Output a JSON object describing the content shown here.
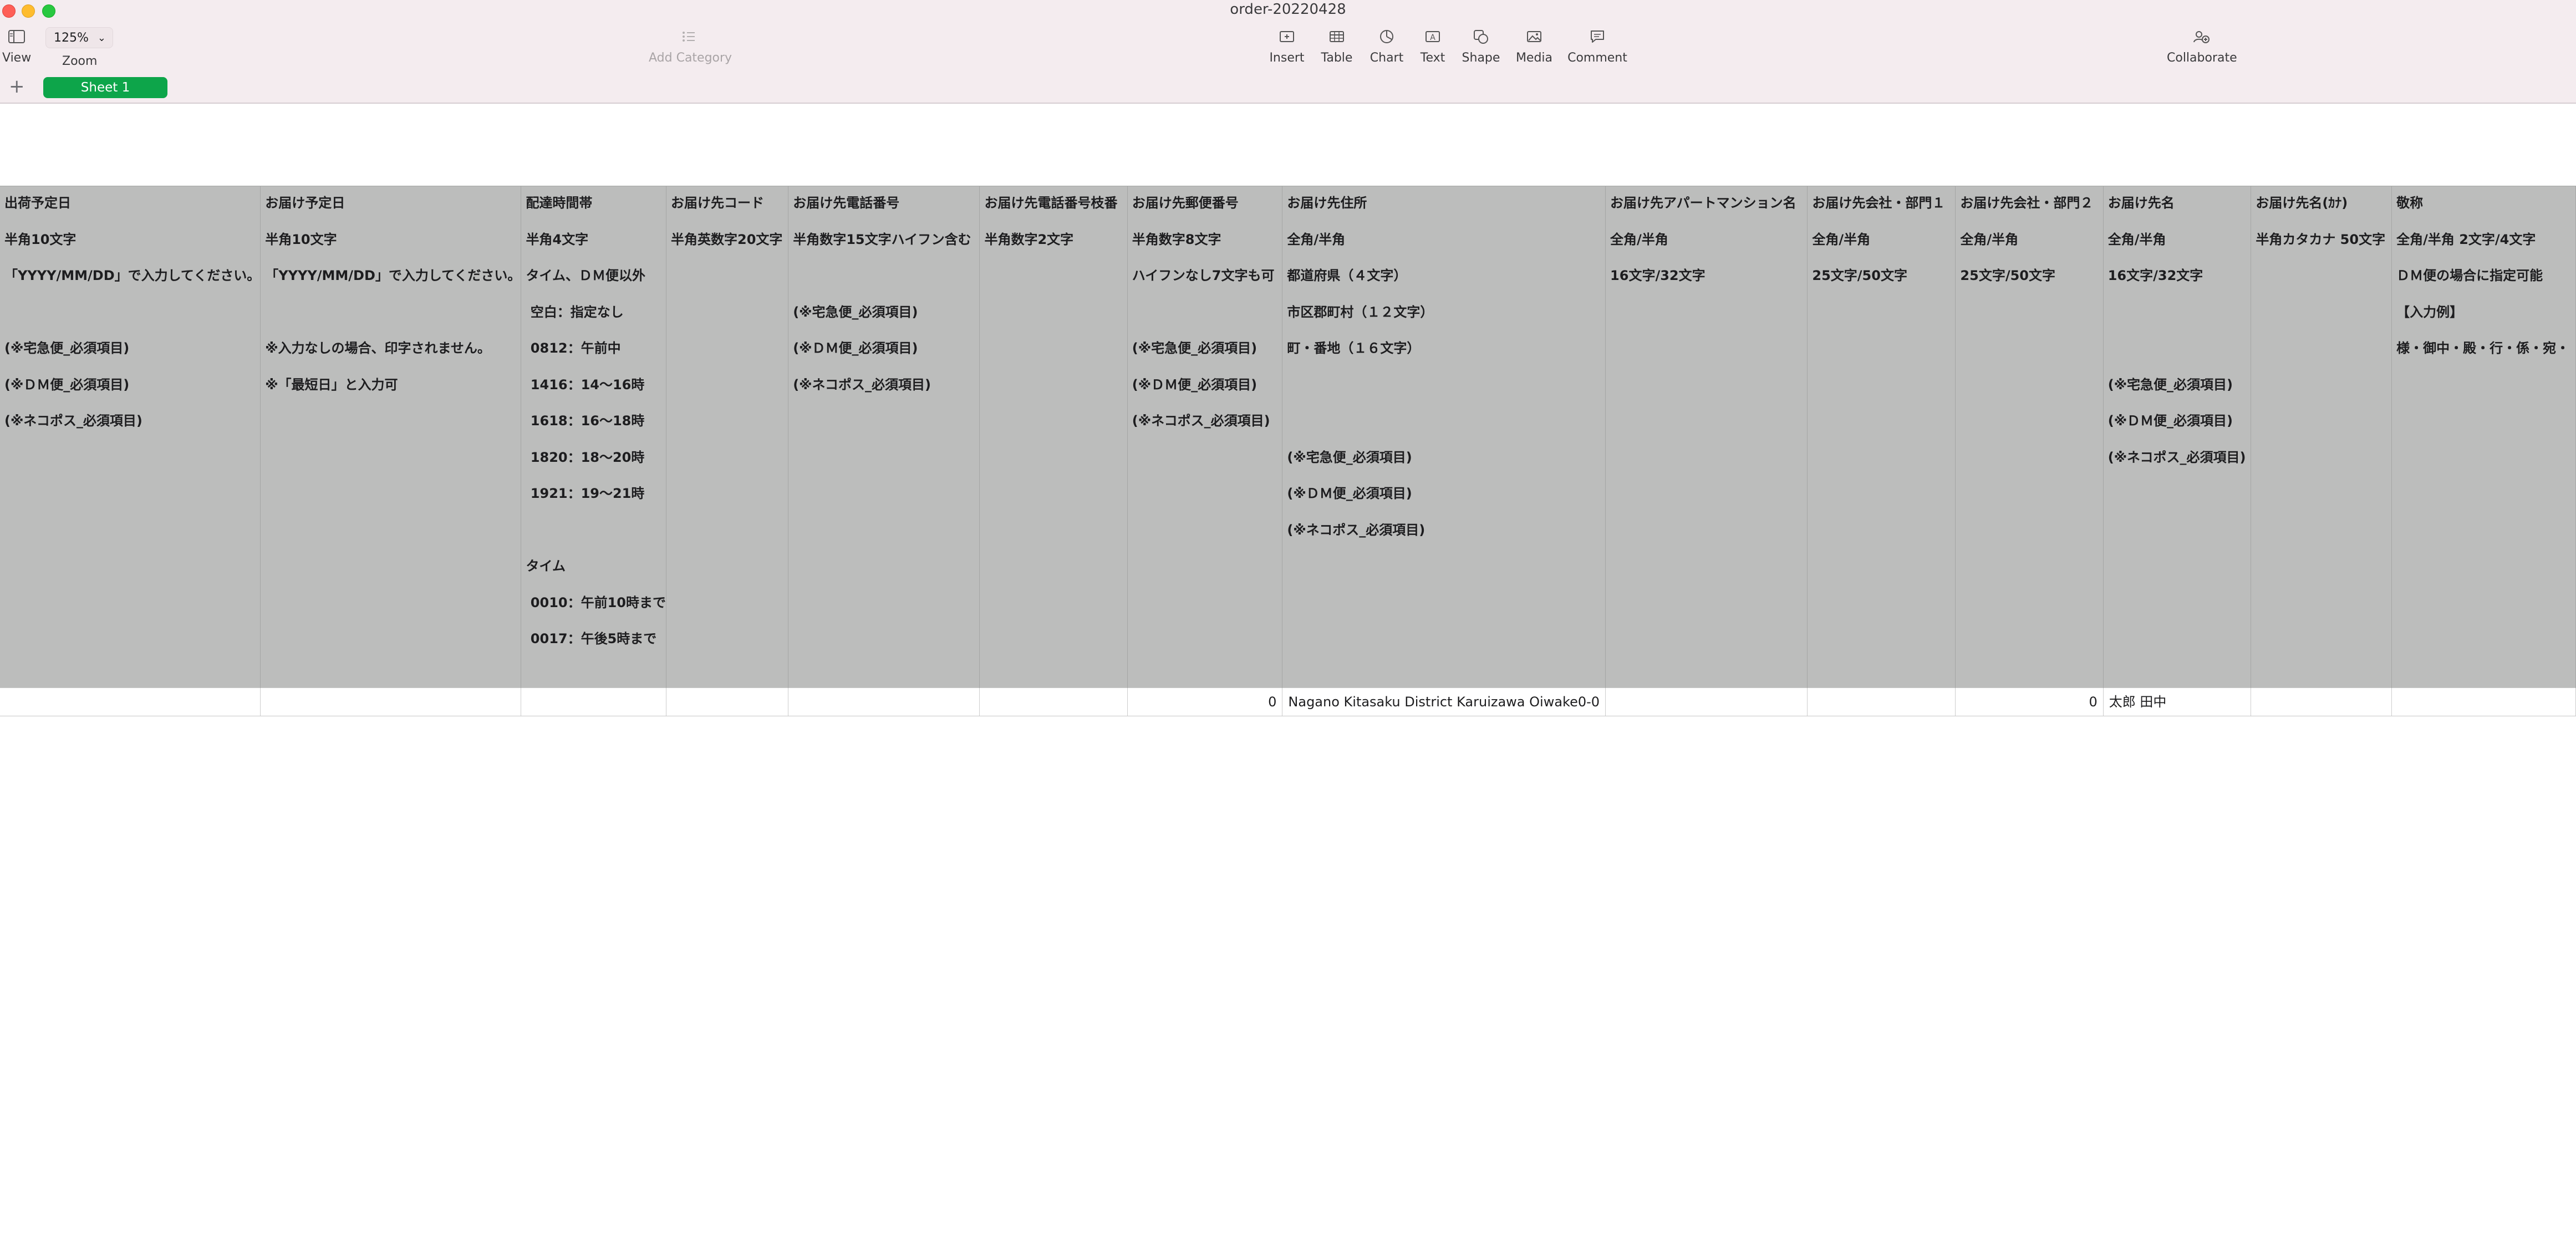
{
  "window": {
    "title": "order-20220428"
  },
  "toolbar": {
    "view_label": "View",
    "zoom_value": "125%",
    "zoom_label": "Zoom",
    "add_category_label": "Add Category",
    "insert_label": "Insert",
    "table_label": "Table",
    "chart_label": "Chart",
    "text_label": "Text",
    "shape_label": "Shape",
    "media_label": "Media",
    "comment_label": "Comment",
    "collaborate_label": "Collaborate"
  },
  "tabs": {
    "add_symbol": "+",
    "sheet_name": "Sheet 1"
  },
  "sheet": {
    "header_cells": [
      [
        "出荷予定日",
        "半角10文字",
        "「YYYY/MM/DD」で入力してください。",
        "",
        "(※宅急便_必須項目)",
        "(※ＤＭ便_必須項目)",
        "(※ネコポス_必須項目)"
      ],
      [
        "お届け予定日",
        "半角10文字",
        "「YYYY/MM/DD」で入力してください。",
        "",
        "※入力なしの場合、印字されません。",
        "※「最短日」と入力可"
      ],
      [
        "配達時間帯",
        "半角4文字",
        "タイム、ＤＭ便以外",
        " 空白：指定なし",
        " 0812：午前中",
        " 1416：14～16時",
        " 1618：16～18時",
        " 1820：18～20時",
        " 1921：19～21時",
        "",
        "タイム",
        " 0010：午前10時まで",
        " 0017：午後5時まで"
      ],
      [
        "お届け先コード",
        "半角英数字20文字"
      ],
      [
        "お届け先電話番号",
        "半角数字15文字ハイフン含む",
        "",
        "(※宅急便_必須項目)",
        "(※ＤＭ便_必須項目)",
        "(※ネコポス_必須項目)"
      ],
      [
        "お届け先電話番号枝番",
        "半角数字2文字"
      ],
      [
        "お届け先郵便番号",
        "半角数字8文字",
        "ハイフンなし7文字も可",
        "",
        "(※宅急便_必須項目)",
        "(※ＤＭ便_必須項目)",
        "(※ネコポス_必須項目)"
      ],
      [
        "お届け先住所",
        "全角/半角",
        "都道府県（４文字）",
        "市区郡町村（１２文字）",
        "町・番地（１６文字）",
        "",
        "",
        "(※宅急便_必須項目)",
        "(※ＤＭ便_必須項目)",
        "(※ネコポス_必須項目)"
      ],
      [
        "お届け先アパートマンション名",
        "全角/半角",
        "16文字/32文字"
      ],
      [
        "お届け先会社・部門１",
        "全角/半角",
        "25文字/50文字"
      ],
      [
        "お届け先会社・部門２",
        "全角/半角",
        "25文字/50文字"
      ],
      [
        "お届け先名",
        "全角/半角",
        "16文字/32文字",
        "",
        "",
        "(※宅急便_必須項目)",
        "(※ＤＭ便_必須項目)",
        "(※ネコポス_必須項目)"
      ],
      [
        "お届け先名(ｶﾅ)",
        "半角カタカナ 50文字"
      ],
      [
        "敬称",
        "全角/半角 2文字/4文字",
        "ＤＭ便の場合に指定可能",
        "【入力例】",
        "様・御中・殿・行・係・宛・"
      ]
    ],
    "data_row": [
      "",
      "",
      "",
      "",
      "",
      "",
      "0",
      "Nagano Kitasaku District Karuizawa Oiwake0-0",
      "",
      "",
      "0",
      "太郎 田中",
      "",
      ""
    ]
  }
}
